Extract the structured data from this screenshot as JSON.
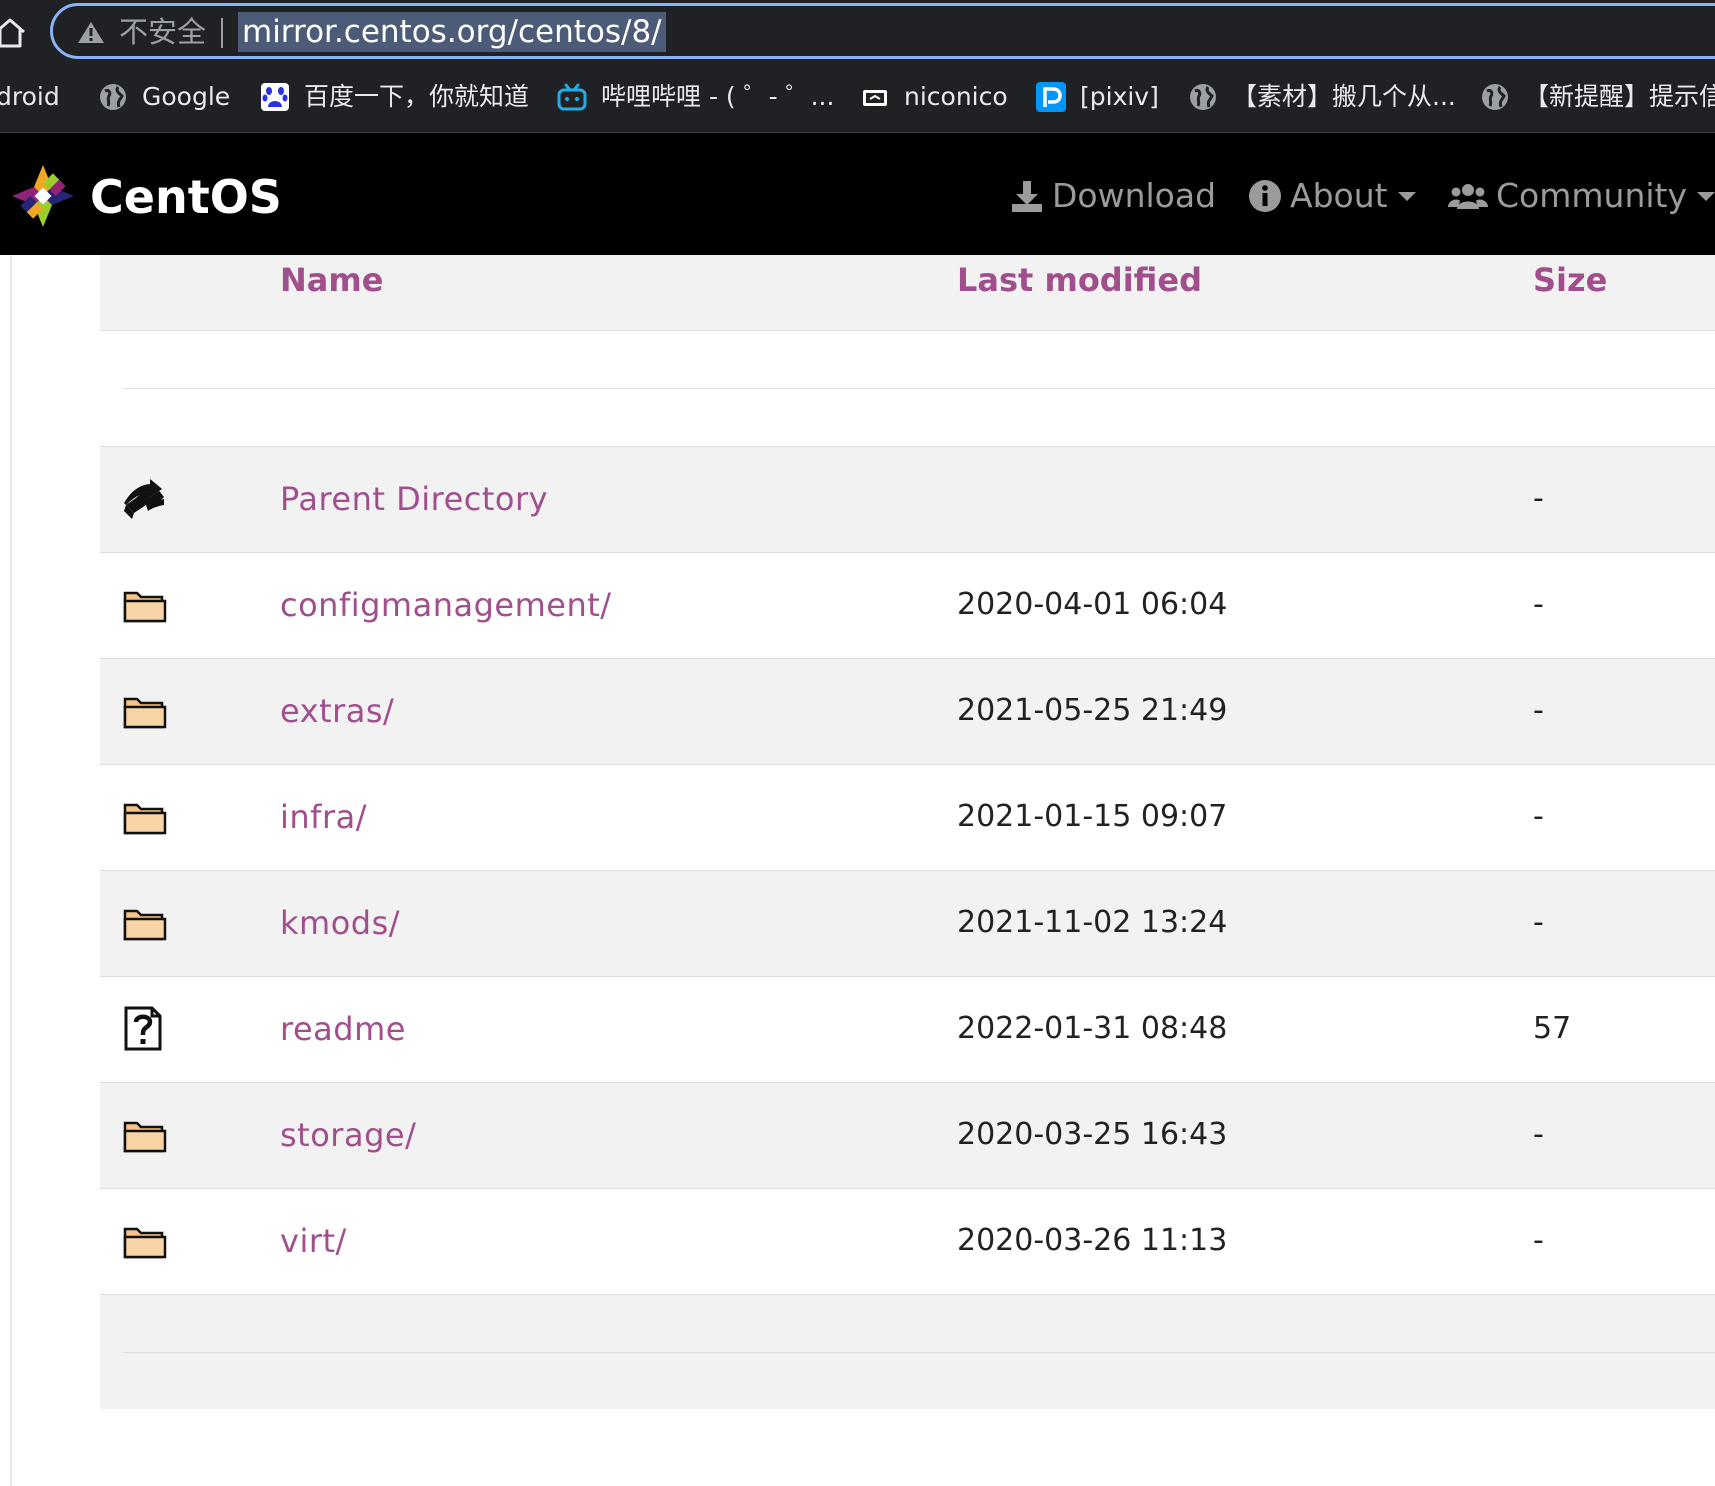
{
  "browser": {
    "insecure_label": "不安全",
    "url": "mirror.centos.org/centos/8/",
    "bookmarks": [
      {
        "label": "droid",
        "icon": "none"
      },
      {
        "label": "Google",
        "icon": "globe-icon"
      },
      {
        "label": "百度一下，你就知道",
        "icon": "baidu-paw-icon"
      },
      {
        "label": "哔哩哔哩 - ( ゜- ゜...",
        "icon": "bilibili-tv-icon"
      },
      {
        "label": "niconico",
        "icon": "niconico-icon"
      },
      {
        "label": "[pixiv]",
        "icon": "pixiv-icon"
      },
      {
        "label": "【素材】搬几个从...",
        "icon": "globe-icon"
      },
      {
        "label": "【新提醒】提示信",
        "icon": "globe-icon"
      }
    ]
  },
  "navbar": {
    "brand": "CentOS",
    "download": "Download",
    "about": "About",
    "community": "Community"
  },
  "listing": {
    "headers": {
      "name": "Name",
      "modified": "Last modified",
      "size": "Size"
    },
    "rows": [
      {
        "icon": "parent-directory-icon",
        "name": "Parent Directory",
        "modified": "",
        "size": "-"
      },
      {
        "icon": "folder-icon",
        "name": "configmanagement/",
        "modified": "2020-04-01 06:04",
        "size": "-"
      },
      {
        "icon": "folder-icon",
        "name": "extras/",
        "modified": "2021-05-25 21:49",
        "size": "-"
      },
      {
        "icon": "folder-icon",
        "name": "infra/",
        "modified": "2021-01-15 09:07",
        "size": "-"
      },
      {
        "icon": "folder-icon",
        "name": "kmods/",
        "modified": "2021-11-02 13:24",
        "size": "-"
      },
      {
        "icon": "unknown-file-icon",
        "name": "readme",
        "modified": "2022-01-31 08:48",
        "size": "57"
      },
      {
        "icon": "folder-icon",
        "name": "storage/",
        "modified": "2020-03-25 16:43",
        "size": "-"
      },
      {
        "icon": "folder-icon",
        "name": "virt/",
        "modified": "2020-03-26 11:13",
        "size": "-"
      }
    ]
  },
  "colors": {
    "link": "#a14f8c",
    "chrome_bg": "#202124",
    "omnibox_focus": "#8ab4f8",
    "navbar_bg": "#000000",
    "folder_fill": "#f6c48a"
  }
}
